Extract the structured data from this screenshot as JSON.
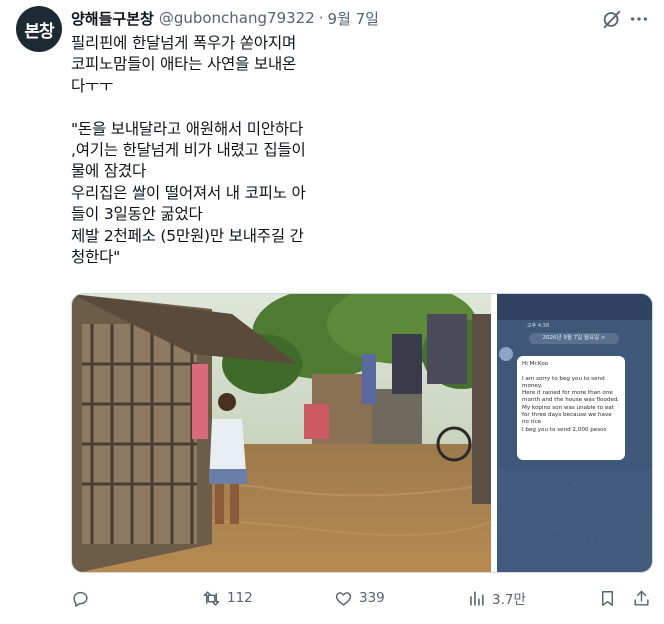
{
  "tweet": {
    "avatar_text": "본창",
    "display_name": "양해들구본창",
    "handle": "@gubonchang79322",
    "separator": "·",
    "date": "9월 7일",
    "text": "필리핀에 한달넘게 폭우가 쏟아지며\n코피노맘들이 애타는 사연을 보내온\n다ㅜㅜ\n\n\"돈을 보내달라고 애원해서 미안하다\n,여기는 한달넘게 비가 내렸고 집들이\n물에 잠겼다\n우리집은 쌀이 떨어져서 내 코피노 아\n들이 3일동안 굶었다\n제발 2천페소 (5만원)만 보내주길 간\n청한다\""
  },
  "chat_screenshot": {
    "status_text": "오후 4:38",
    "date_label": "2026년 9월 7일 월요일 >",
    "message_lines": "Hi Mr.Koo\n\nI am sorry to beg you to send money.\nHere it rained for more than one month and the house was flooded.\nMy kopino son was unable to eat for three days because we have no rice\nI beg you to send 2,000 pesos"
  },
  "actions": {
    "reply_count": "",
    "retweet_count": "112",
    "like_count": "339",
    "views_count": "3.7만"
  },
  "icons": [
    "grok-icon",
    "more-icon",
    "reply-icon",
    "retweet-icon",
    "like-icon",
    "views-icon",
    "bookmark-icon",
    "share-icon"
  ],
  "colors": {
    "text_primary": "#0f1419",
    "text_secondary": "#536471",
    "border": "#cfd9de"
  }
}
